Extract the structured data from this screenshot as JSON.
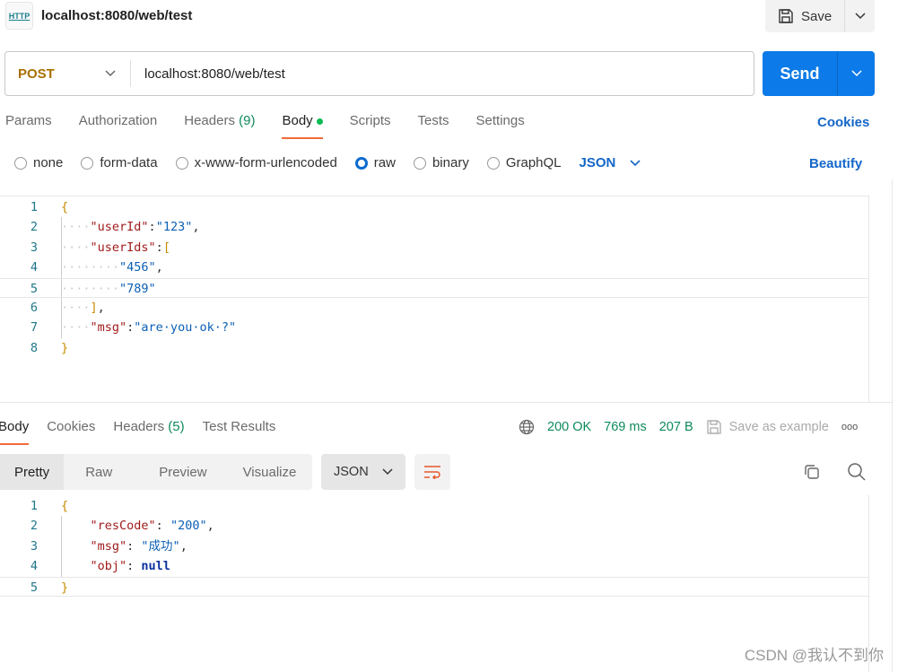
{
  "header": {
    "icon_label": "HTTP",
    "title": "localhost:8080/web/test",
    "save_label": "Save"
  },
  "request": {
    "method": "POST",
    "url": "localhost:8080/web/test",
    "send_label": "Send"
  },
  "tabs": [
    {
      "label": "Params"
    },
    {
      "label": "Authorization"
    },
    {
      "label": "Headers",
      "count": "(9)"
    },
    {
      "label": "Body"
    },
    {
      "label": "Scripts"
    },
    {
      "label": "Tests"
    },
    {
      "label": "Settings"
    }
  ],
  "cookies_label": "Cookies",
  "body_types": [
    "none",
    "form-data",
    "x-www-form-urlencoded",
    "raw",
    "binary",
    "GraphQL"
  ],
  "selected_body_type": "raw",
  "raw_format": "JSON",
  "beautify_label": "Beautify",
  "request_body": [
    [
      [
        "b",
        "{"
      ]
    ],
    [
      [
        "w",
        "····"
      ],
      [
        "k",
        "\"userId\""
      ],
      [
        "p",
        ":"
      ],
      [
        "s",
        "\"123\""
      ],
      [
        "p",
        ","
      ]
    ],
    [
      [
        "w",
        "····"
      ],
      [
        "k",
        "\"userIds\""
      ],
      [
        "p",
        ":"
      ],
      [
        "b",
        "["
      ]
    ],
    [
      [
        "w",
        "········"
      ],
      [
        "s",
        "\"456\""
      ],
      [
        "p",
        ","
      ]
    ],
    [
      [
        "w",
        "········"
      ],
      [
        "s",
        "\"789\""
      ]
    ],
    [
      [
        "w",
        "····"
      ],
      [
        "b",
        "]"
      ],
      [
        "p",
        ","
      ]
    ],
    [
      [
        "w",
        "····"
      ],
      [
        "k",
        "\"msg\""
      ],
      [
        "p",
        ":"
      ],
      [
        "s",
        "\"are·you·ok·?\""
      ]
    ],
    [
      [
        "b",
        "}"
      ]
    ]
  ],
  "response_tabs": [
    {
      "label": "Body"
    },
    {
      "label": "Cookies"
    },
    {
      "label": "Headers",
      "count": "(5)"
    },
    {
      "label": "Test Results"
    }
  ],
  "status": {
    "code": "200 OK",
    "time": "769 ms",
    "size": "207 B",
    "save_example": "Save as example",
    "more": "ooo"
  },
  "view_modes": [
    "Pretty",
    "Raw",
    "Preview",
    "Visualize"
  ],
  "response_format": "JSON",
  "response_body": [
    [
      [
        "b",
        "{"
      ]
    ],
    [
      [
        "p",
        "    "
      ],
      [
        "k",
        "\"resCode\""
      ],
      [
        "p",
        ": "
      ],
      [
        "s",
        "\"200\""
      ],
      [
        "p",
        ","
      ]
    ],
    [
      [
        "p",
        "    "
      ],
      [
        "k",
        "\"msg\""
      ],
      [
        "p",
        ": "
      ],
      [
        "s",
        "\"成功\""
      ],
      [
        "p",
        ","
      ]
    ],
    [
      [
        "p",
        "    "
      ],
      [
        "k",
        "\"obj\""
      ],
      [
        "p",
        ": "
      ],
      [
        "n",
        "null"
      ]
    ],
    [
      [
        "b",
        "}"
      ]
    ]
  ],
  "watermark": "CSDN @我认不到你",
  "colors": {
    "accent": "#0c7ae8",
    "method": "#a96f00",
    "status_ok": "#0e8a5a",
    "tab_underline": "#f26b3a"
  }
}
